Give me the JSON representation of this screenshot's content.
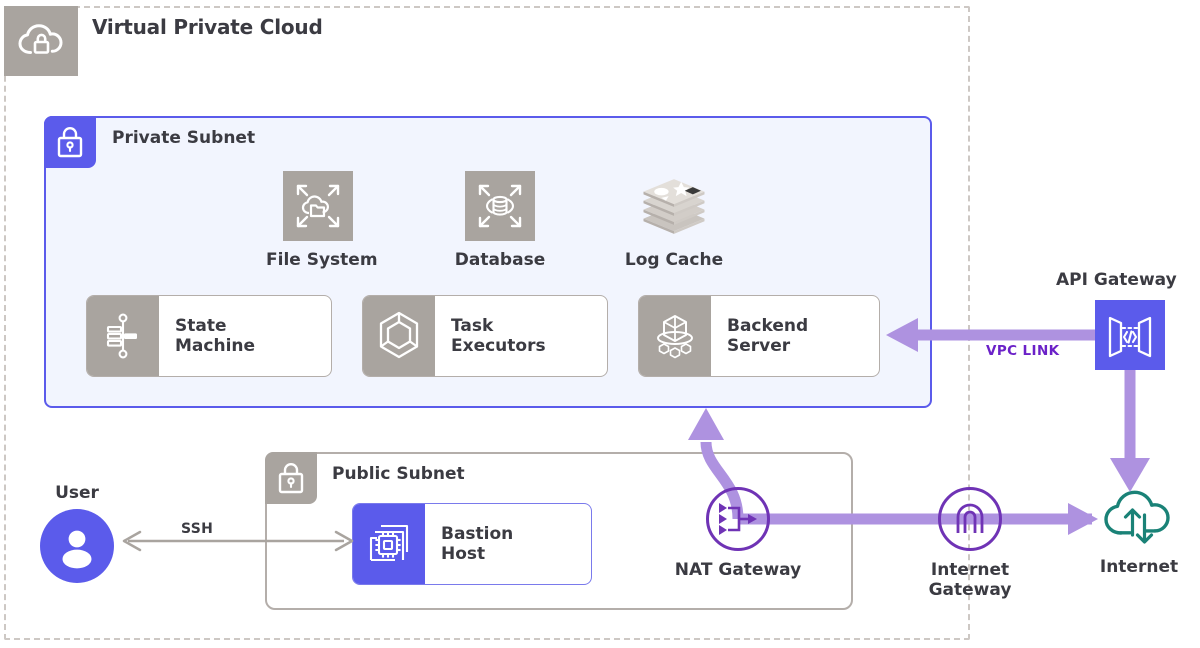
{
  "diagram": {
    "title": "Virtual Private Cloud"
  },
  "vpc": {
    "label": "Virtual Private Cloud",
    "icon": "cloud-lock-icon",
    "border_color": "#cdc8c4",
    "badge_color": "#a9a49f"
  },
  "private_subnet": {
    "label": "Private Subnet",
    "icon": "lock-icon",
    "border_color": "#5b5beb",
    "fill_color": "#f2f5fe",
    "badge_color": "#5b5beb",
    "services": [
      {
        "label": "File System",
        "icon": "elastic-file-system-icon",
        "style": "gray-square"
      },
      {
        "label": "Database",
        "icon": "database-cylinder-icon",
        "style": "gray-square"
      },
      {
        "label": "Log Cache",
        "icon": "redis-stack-icon",
        "style": "plain"
      }
    ],
    "components": [
      {
        "label": "State\nMachine",
        "icon": "state-machine-icon",
        "style": "gray"
      },
      {
        "label": "Task\nExecutors",
        "icon": "hexagon-cube-icon",
        "style": "gray"
      },
      {
        "label": "Backend\nServer",
        "icon": "container-cube-icon",
        "style": "gray"
      }
    ]
  },
  "public_subnet": {
    "label": "Public Subnet",
    "icon": "lock-icon",
    "border_color": "#b4aeaa",
    "badge_color": "#a9a49f",
    "components": [
      {
        "label": "Bastion\nHost",
        "icon": "ec2-instances-icon",
        "style": "purple"
      }
    ]
  },
  "actors": {
    "user": {
      "label": "User",
      "icon": "user-avatar-icon",
      "color": "#5b5beb"
    }
  },
  "gateways": [
    {
      "id": "nat",
      "label": "NAT Gateway",
      "icon": "nat-gateway-icon",
      "color": "#6f33b5"
    },
    {
      "id": "internet",
      "label": "Internet\nGateway",
      "icon": "internet-gateway-icon",
      "color": "#6f33b5"
    }
  ],
  "external": {
    "api_gateway": {
      "label": "API Gateway",
      "icon": "api-gateway-icon",
      "color": "#5b5beb"
    },
    "internet": {
      "label": "Internet",
      "icon": "internet-cloud-icon",
      "color": "#1a8277"
    }
  },
  "connections": [
    {
      "id": "ssh",
      "label": "SSH",
      "from": "user",
      "to": "bastion-host",
      "style": "gray-double-arrow"
    },
    {
      "id": "vpc-link",
      "label": "VPC LINK",
      "from": "api-gateway",
      "to": "backend-server",
      "style": "purple-arrow"
    },
    {
      "id": "nat-uplink",
      "label": "",
      "from": "nat-gateway",
      "to": "private-subnet",
      "style": "purple-arrow"
    },
    {
      "id": "nat-to-igw",
      "label": "",
      "from": "nat-gateway",
      "to": "internet",
      "style": "purple-arrow"
    },
    {
      "id": "apigw-to-internet",
      "label": "",
      "from": "api-gateway",
      "to": "internet",
      "style": "purple-arrow"
    }
  ],
  "colors": {
    "purple_primary": "#5b5beb",
    "purple_dark": "#6f33b5",
    "purple_light": "#ae92e0",
    "gray_icon": "#a9a49f",
    "teal": "#1a8277",
    "text": "#3b3b42",
    "subnet_fill": "#f2f5fe"
  }
}
